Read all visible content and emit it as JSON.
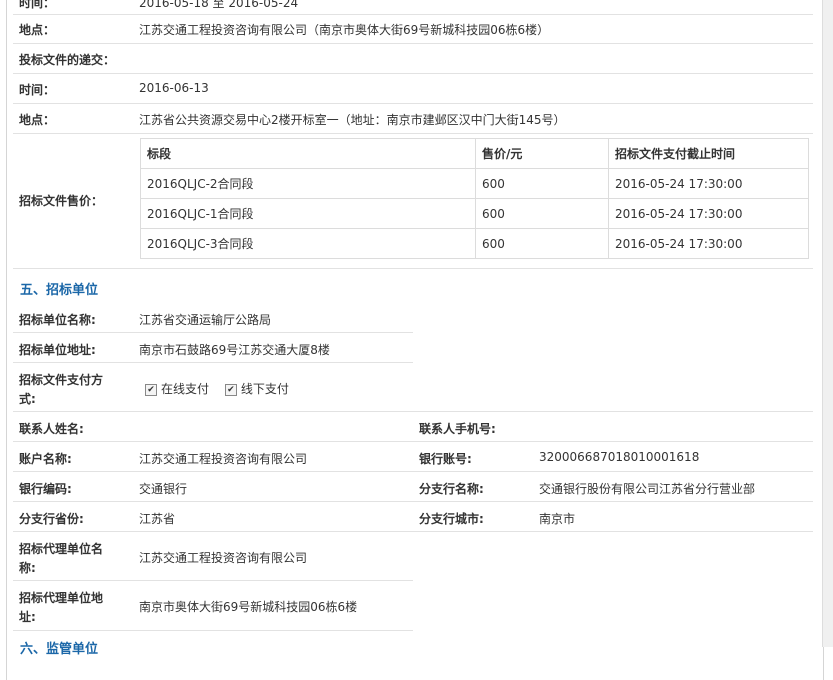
{
  "top_partial": {
    "label": "时间：",
    "value": "2016-05-18 至 2016-05-24"
  },
  "bid_place": {
    "label": "地点：",
    "value": "江苏交通工程投资咨询有限公司（南京市奥体大街69号新城科技园06栋6楼）"
  },
  "submission": {
    "label": "投标文件的递交："
  },
  "sub_time": {
    "label": "时间：",
    "value": "2016-06-13"
  },
  "sub_place": {
    "label": "地点：",
    "value": "江苏省公共资源交易中心2楼开标室一（地址：南京市建邺区汉中门大街145号）"
  },
  "fee": {
    "label": "招标文件售价：",
    "headers": [
      "标段",
      "售价/元",
      "招标文件支付截止时间"
    ],
    "rows": [
      [
        "2016QLJC-2合同段",
        "600",
        "2016-05-24 17:30:00"
      ],
      [
        "2016QLJC-1合同段",
        "600",
        "2016-05-24 17:30:00"
      ],
      [
        "2016QLJC-3合同段",
        "600",
        "2016-05-24 17:30:00"
      ]
    ]
  },
  "section5": "五、招标单位",
  "unit_name": {
    "label": "招标单位名称:",
    "value": "江苏省交通运输厅公路局"
  },
  "unit_addr": {
    "label": "招标单位地址:",
    "value": "南京市石鼓路69号江苏交通大厦8楼"
  },
  "pay_method": {
    "label_line1": "招标文件支付方",
    "label_line2": "式:",
    "option1": "在线支付",
    "option2": "线下支付"
  },
  "contact": {
    "label": "联系人姓名:",
    "value": "",
    "phone_label": "联系人手机号:",
    "phone_value": ""
  },
  "account": {
    "label": "账户名称:",
    "value": "江苏交通工程投资咨询有限公司",
    "bank_label": "银行账号:",
    "bank_value": "320006687018010001618"
  },
  "bank": {
    "label": "银行编码:",
    "value": "交通银行",
    "branch_label": "分支行名称:",
    "branch_value": "交通银行股份有限公司江苏省分行营业部"
  },
  "province": {
    "label": "分支行省份:",
    "value": "江苏省",
    "city_label": "分支行城市:",
    "city_value": "南京市"
  },
  "agent_name": {
    "label_line1": "招标代理单位名",
    "label_line2": "称:",
    "value": "江苏交通工程投资咨询有限公司"
  },
  "agent_addr": {
    "label_line1": "招标代理单位地",
    "label_line2": "址:",
    "value": "南京市奥体大街69号新城科技园06栋6楼"
  },
  "section6": "六、监管单位"
}
